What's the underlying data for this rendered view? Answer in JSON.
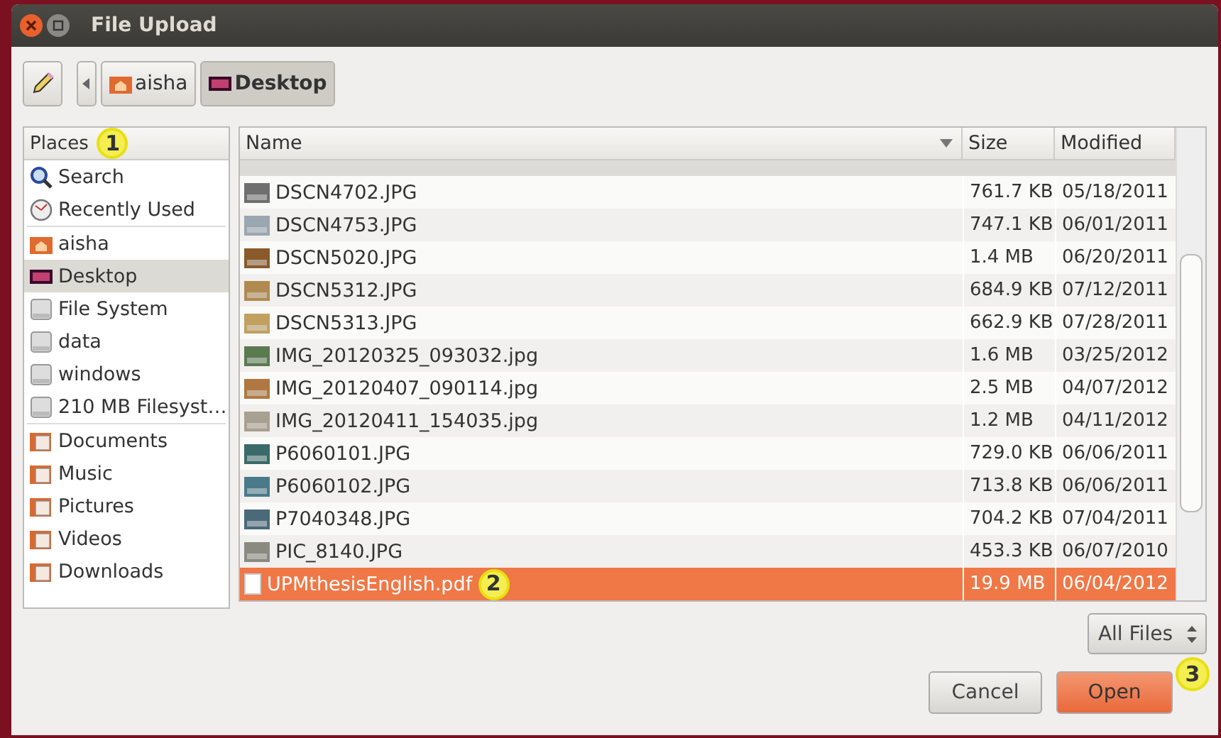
{
  "window": {
    "title": "File Upload"
  },
  "toolbar": {
    "path": [
      {
        "label": "aisha",
        "kind": "home",
        "selected": false
      },
      {
        "label": "Desktop",
        "kind": "desktop",
        "selected": true
      }
    ]
  },
  "places": {
    "heading": "Places",
    "callout": "1",
    "groups": [
      [
        {
          "label": "Search",
          "kind": "search",
          "selected": false
        },
        {
          "label": "Recently Used",
          "kind": "clock",
          "selected": false
        }
      ],
      [
        {
          "label": "aisha",
          "kind": "home",
          "selected": false
        },
        {
          "label": "Desktop",
          "kind": "desktop",
          "selected": true
        },
        {
          "label": "File System",
          "kind": "drive",
          "selected": false
        },
        {
          "label": "data",
          "kind": "drive",
          "selected": false
        },
        {
          "label": "windows",
          "kind": "drive",
          "selected": false
        },
        {
          "label": "210 MB Filesyst…",
          "kind": "drive",
          "selected": false
        }
      ],
      [
        {
          "label": "Documents",
          "kind": "folder",
          "selected": false
        },
        {
          "label": "Music",
          "kind": "folder",
          "selected": false
        },
        {
          "label": "Pictures",
          "kind": "folder",
          "selected": false
        },
        {
          "label": "Videos",
          "kind": "folder",
          "selected": false
        },
        {
          "label": "Downloads",
          "kind": "folder",
          "selected": false
        }
      ]
    ]
  },
  "table": {
    "columns": [
      "Name",
      "Size",
      "Modified"
    ],
    "rows": [
      {
        "name": "DSCN4702.JPG",
        "size": "761.7 KB",
        "modified": "05/18/2011",
        "kind": "image",
        "color": "#6f6f6f",
        "selected": false
      },
      {
        "name": "DSCN4753.JPG",
        "size": "747.1 KB",
        "modified": "06/01/2011",
        "kind": "image",
        "color": "#9aa6b0",
        "selected": false
      },
      {
        "name": "DSCN5020.JPG",
        "size": "1.4 MB",
        "modified": "06/20/2011",
        "kind": "image",
        "color": "#8a5a2a",
        "selected": false
      },
      {
        "name": "DSCN5312.JPG",
        "size": "684.9 KB",
        "modified": "07/12/2011",
        "kind": "image",
        "color": "#b08a50",
        "selected": false
      },
      {
        "name": "DSCN5313.JPG",
        "size": "662.9 KB",
        "modified": "07/28/2011",
        "kind": "image",
        "color": "#c2a060",
        "selected": false
      },
      {
        "name": "IMG_20120325_093032.jpg",
        "size": "1.6 MB",
        "modified": "03/25/2012",
        "kind": "image",
        "color": "#5a7a50",
        "selected": false
      },
      {
        "name": "IMG_20120407_090114.jpg",
        "size": "2.5 MB",
        "modified": "04/07/2012",
        "kind": "image",
        "color": "#b07840",
        "selected": false
      },
      {
        "name": "IMG_20120411_154035.jpg",
        "size": "1.2 MB",
        "modified": "04/11/2012",
        "kind": "image",
        "color": "#a8a090",
        "selected": false
      },
      {
        "name": "P6060101.JPG",
        "size": "729.0 KB",
        "modified": "06/06/2011",
        "kind": "image",
        "color": "#3a6a6a",
        "selected": false
      },
      {
        "name": "P6060102.JPG",
        "size": "713.8 KB",
        "modified": "06/06/2011",
        "kind": "image",
        "color": "#4a7a8a",
        "selected": false
      },
      {
        "name": "P7040348.JPG",
        "size": "704.2 KB",
        "modified": "07/04/2011",
        "kind": "image",
        "color": "#4a6a7a",
        "selected": false
      },
      {
        "name": "PIC_8140.JPG",
        "size": "453.3 KB",
        "modified": "06/07/2010",
        "kind": "image",
        "color": "#8a8a80",
        "selected": false
      },
      {
        "name": "UPMthesisEnglish.pdf",
        "size": "19.9 MB",
        "modified": "06/04/2012",
        "kind": "document",
        "selected": true,
        "callout": "2"
      }
    ]
  },
  "filter": {
    "label": "All Files"
  },
  "buttons": [
    {
      "label": "Cancel",
      "default": false
    },
    {
      "label": "Open",
      "default": true,
      "callout": "3"
    }
  ]
}
